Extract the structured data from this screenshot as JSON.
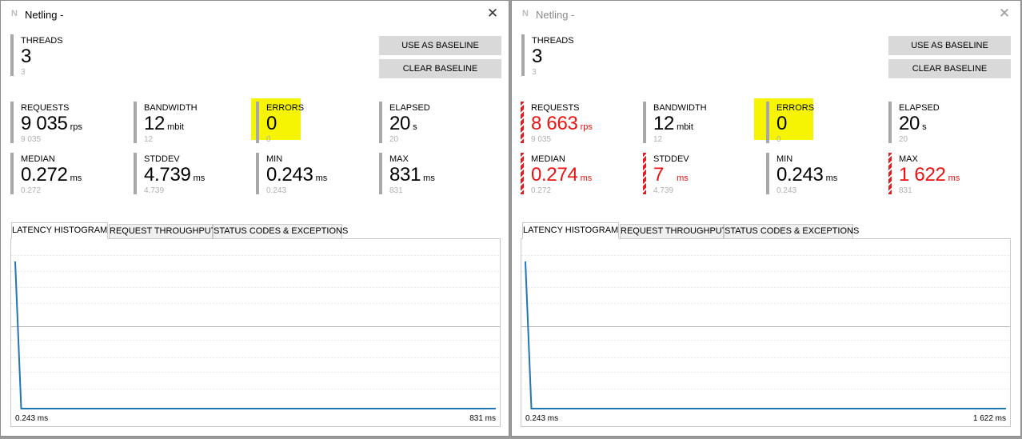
{
  "colors": {
    "worse": "#e11111",
    "line": "#1f77b4",
    "highlight": "#f6f400",
    "neutral_bar": "#a8a8a8"
  },
  "windows": [
    {
      "app_icon": "N",
      "title": "Netling -",
      "close_glyph": "✕",
      "threads": {
        "label": "THREADS",
        "value": "3",
        "baseline": "3"
      },
      "buttons": {
        "use_baseline": "USE AS BASELINE",
        "clear_baseline": "CLEAR BASELINE"
      },
      "metrics": {
        "requests": {
          "label": "REQUESTS",
          "value": "9 035",
          "unit": "rps",
          "baseline": "9 035",
          "worse": false
        },
        "bandwidth": {
          "label": "BANDWIDTH",
          "value": "12",
          "unit": "mbit",
          "baseline": "12",
          "worse": false
        },
        "errors": {
          "label": "ERRORS",
          "value": "0",
          "unit": "",
          "baseline": "0",
          "worse": false
        },
        "elapsed": {
          "label": "ELAPSED",
          "value": "20",
          "unit": "s",
          "baseline": "20",
          "worse": false
        },
        "median": {
          "label": "MEDIAN",
          "value": "0.272",
          "unit": "ms",
          "baseline": "0.272",
          "worse": false
        },
        "stddev": {
          "label": "STDDEV",
          "value": "4.739",
          "unit": "ms",
          "baseline": "4.739",
          "worse": false
        },
        "min": {
          "label": "MIN",
          "value": "0.243",
          "unit": "ms",
          "baseline": "0.243",
          "worse": false
        },
        "max": {
          "label": "MAX",
          "value": "831",
          "unit": "ms",
          "baseline": "831",
          "worse": false
        }
      },
      "tabs": [
        "LATENCY HISTOGRAM",
        "REQUEST THROUGHPUT",
        "STATUS CODES & EXCEPTIONS"
      ],
      "active_tab": 0,
      "chart_data": {
        "type": "line",
        "x_min_label": "0.243 ms",
        "x_max_label": "831 ms",
        "grid": true,
        "values": [
          1.0,
          0.0,
          0.0,
          0.0,
          0.0,
          0.0,
          0.0,
          0.0,
          0.0,
          0.0,
          0.0,
          0.0,
          0.0,
          0.0,
          0.0,
          0.0,
          0.0,
          0.0,
          0.0,
          0.0,
          0.0,
          0.0,
          0.0,
          0.0,
          0.0,
          0.0,
          0.0,
          0.0,
          0.0,
          0.0,
          0.0,
          0.0,
          0.0,
          0.0,
          0.0,
          0.0,
          0.0,
          0.0,
          0.0,
          0.0,
          0.0,
          0.0,
          0.0,
          0.0,
          0.0,
          0.0,
          0.0,
          0.0,
          0.0,
          0.0,
          0.0,
          0.0,
          0.0,
          0.0,
          0.0,
          0.0,
          0.0,
          0.0,
          0.0,
          0.0,
          0.0,
          0.0,
          0.0,
          0.0,
          0.0,
          0.0,
          0.0,
          0.0,
          0.0,
          0.0,
          0.0,
          0.0,
          0.0,
          0.0,
          0.0,
          0.0,
          0.0,
          0.0,
          0.0,
          0.0,
          0.0
        ]
      }
    },
    {
      "app_icon": "N",
      "title": "Netling -",
      "close_glyph": "✕",
      "threads": {
        "label": "THREADS",
        "value": "3",
        "baseline": "3"
      },
      "buttons": {
        "use_baseline": "USE AS BASELINE",
        "clear_baseline": "CLEAR BASELINE"
      },
      "metrics": {
        "requests": {
          "label": "REQUESTS",
          "value": "8 663",
          "unit": "rps",
          "baseline": "9 035",
          "worse": true
        },
        "bandwidth": {
          "label": "BANDWIDTH",
          "value": "12",
          "unit": "mbit",
          "baseline": "12",
          "worse": false
        },
        "errors": {
          "label": "ERRORS",
          "value": "0",
          "unit": "",
          "baseline": "0",
          "worse": false
        },
        "elapsed": {
          "label": "ELAPSED",
          "value": "20",
          "unit": "s",
          "baseline": "20",
          "worse": false
        },
        "median": {
          "label": "MEDIAN",
          "value": "0.274",
          "unit": "ms",
          "baseline": "0.272",
          "worse": true
        },
        "stddev": {
          "label": "STDDEV",
          "value": "7",
          "unit": "ms",
          "baseline": "4.739",
          "worse": true
        },
        "min": {
          "label": "MIN",
          "value": "0.243",
          "unit": "ms",
          "baseline": "0.243",
          "worse": false
        },
        "max": {
          "label": "MAX",
          "value": "1 622",
          "unit": "ms",
          "baseline": "831",
          "worse": true
        }
      },
      "tabs": [
        "LATENCY HISTOGRAM",
        "REQUEST THROUGHPUT",
        "STATUS CODES & EXCEPTIONS"
      ],
      "active_tab": 0,
      "chart_data": {
        "type": "line",
        "x_min_label": "0.243 ms",
        "x_max_label": "1 622 ms",
        "grid": true,
        "values": [
          1.0,
          0.0,
          0.0,
          0.0,
          0.0,
          0.0,
          0.0,
          0.0,
          0.0,
          0.0,
          0.0,
          0.0,
          0.0,
          0.0,
          0.0,
          0.0,
          0.0,
          0.0,
          0.0,
          0.0,
          0.0,
          0.0,
          0.0,
          0.0,
          0.0,
          0.0,
          0.0,
          0.0,
          0.0,
          0.0,
          0.0,
          0.0,
          0.0,
          0.0,
          0.0,
          0.0,
          0.0,
          0.0,
          0.0,
          0.0,
          0.0,
          0.0,
          0.0,
          0.0,
          0.0,
          0.0,
          0.0,
          0.0,
          0.0,
          0.0,
          0.0,
          0.0,
          0.0,
          0.0,
          0.0,
          0.0,
          0.0,
          0.0,
          0.0,
          0.0,
          0.0,
          0.0,
          0.0,
          0.0,
          0.0,
          0.0,
          0.0,
          0.0,
          0.0,
          0.0,
          0.0,
          0.0,
          0.0,
          0.0,
          0.0,
          0.0,
          0.0,
          0.0,
          0.0,
          0.0,
          0.0
        ]
      }
    }
  ]
}
